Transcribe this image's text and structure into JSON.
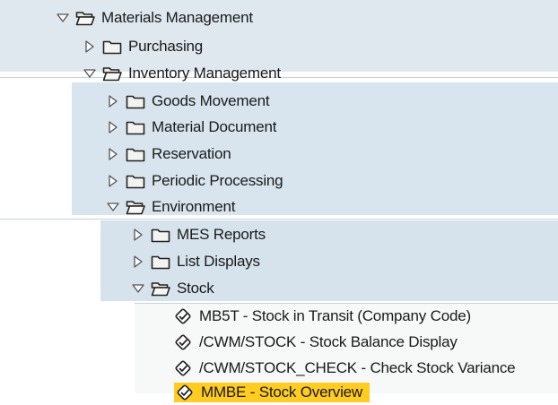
{
  "tree": {
    "materials_management": {
      "label": "Materials Management",
      "expanded": true,
      "icon": "open-folder-icon"
    },
    "purchasing": {
      "label": "Purchasing",
      "expanded": false,
      "icon": "folder-icon"
    },
    "inventory_management": {
      "label": "Inventory Management",
      "expanded": true,
      "icon": "open-folder-icon"
    },
    "goods_movement": {
      "label": "Goods Movement",
      "expanded": false,
      "icon": "folder-icon"
    },
    "material_document": {
      "label": "Material Document",
      "expanded": false,
      "icon": "folder-icon"
    },
    "reservation": {
      "label": "Reservation",
      "expanded": false,
      "icon": "folder-icon"
    },
    "periodic_processing": {
      "label": "Periodic Processing",
      "expanded": false,
      "icon": "folder-icon"
    },
    "environment": {
      "label": "Environment",
      "expanded": true,
      "icon": "open-folder-icon"
    },
    "mes_reports": {
      "label": "MES Reports",
      "expanded": false,
      "icon": "folder-icon"
    },
    "list_displays": {
      "label": "List Displays",
      "expanded": false,
      "icon": "folder-icon"
    },
    "stock": {
      "label": "Stock",
      "expanded": true,
      "icon": "open-folder-icon"
    },
    "transactions": [
      {
        "label": "MB5T - Stock in Transit (Company Code)",
        "icon": "transaction-icon",
        "selected": false
      },
      {
        "label": "/CWM/STOCK - Stock Balance Display",
        "icon": "transaction-icon",
        "selected": false
      },
      {
        "label": "/CWM/STOCK_CHECK - Check Stock Variance",
        "icon": "transaction-icon",
        "selected": false
      },
      {
        "label": "MMBE - Stock Overview",
        "icon": "transaction-icon",
        "selected": true
      }
    ]
  },
  "colors": {
    "selection": "#ffcc21",
    "band_light": "#dfe8ef",
    "band_mid": "#d9e5ee"
  }
}
